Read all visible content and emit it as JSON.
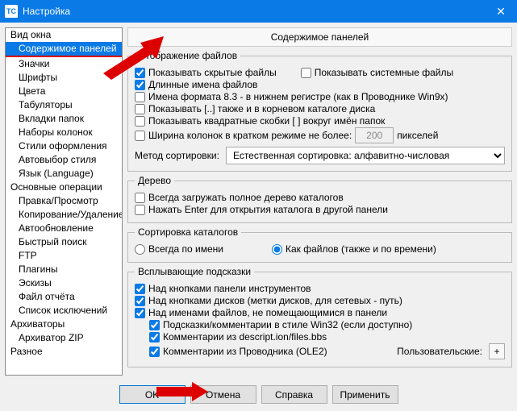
{
  "window": {
    "title": "Настройка"
  },
  "tree": {
    "items": [
      {
        "label": "Вид окна",
        "indent": 0
      },
      {
        "label": "Содержимое панелей",
        "indent": 1,
        "selected": true
      },
      {
        "label": "Значки",
        "indent": 1
      },
      {
        "label": "Шрифты",
        "indent": 1
      },
      {
        "label": "Цвета",
        "indent": 1
      },
      {
        "label": "Табуляторы",
        "indent": 1
      },
      {
        "label": "Вкладки папок",
        "indent": 1
      },
      {
        "label": "Наборы колонок",
        "indent": 1
      },
      {
        "label": "Стили оформления",
        "indent": 1
      },
      {
        "label": "Автовыбор стиля",
        "indent": 2
      },
      {
        "label": "Язык (Language)",
        "indent": 1
      },
      {
        "label": "Основные операции",
        "indent": 0
      },
      {
        "label": "Правка/Просмотр",
        "indent": 1
      },
      {
        "label": "Копирование/Удаление",
        "indent": 1
      },
      {
        "label": "Автообновление",
        "indent": 1
      },
      {
        "label": "Быстрый поиск",
        "indent": 1
      },
      {
        "label": "FTP",
        "indent": 1
      },
      {
        "label": "Плагины",
        "indent": 1
      },
      {
        "label": "Эскизы",
        "indent": 1
      },
      {
        "label": "Файл отчёта",
        "indent": 1
      },
      {
        "label": "Список исключений",
        "indent": 1
      },
      {
        "label": "Архиваторы",
        "indent": 0
      },
      {
        "label": "Архиватор ZIP",
        "indent": 1
      },
      {
        "label": "Разное",
        "indent": 0
      }
    ]
  },
  "header": "Содержимое панелей",
  "groups": {
    "display": {
      "legend": "Отображение файлов",
      "show_hidden": "Показывать скрытые файлы",
      "show_system": "Показывать системные файлы",
      "long_names": "Длинные имена файлов",
      "names_83": "Имена формата 8.3 - в нижнем регистре (как в Проводнике Win9x)",
      "show_dotdot": "Показывать [..] также и в корневом каталоге диска",
      "show_brackets": "Показывать квадратные скобки [ ] вокруг имён папок",
      "col_width_label": "Ширина колонок в кратком режиме не более:",
      "col_width_value": "200",
      "col_width_suffix": "пикселей",
      "sort_method_label": "Метод сортировки:",
      "sort_method_value": "Естественная сортировка: алфавитно-числовая"
    },
    "tree": {
      "legend": "Дерево",
      "always_load": "Всегда загружать полное дерево каталогов",
      "enter_open": "Нажать Enter для открытия каталога в другой панели"
    },
    "sort": {
      "legend": "Сортировка каталогов",
      "by_name": "Всегда по имени",
      "like_files": "Как файлов (также и по времени)"
    },
    "tooltips": {
      "legend": "Всплывающие подсказки",
      "over_toolbar": "Над кнопками панели инструментов",
      "over_drives": "Над кнопками дисков (метки дисков, для сетевых - путь)",
      "over_names": "Над именами файлов, не помещающимися в панели",
      "win32_hints": "Подсказки/комментарии в стиле Win32 (если доступно)",
      "descript_ion": "Комментарии из descript.ion/files.bbs",
      "ole2": "Комментарии из Проводника (OLE2)",
      "custom_label": "Пользовательские:",
      "plus": "+"
    }
  },
  "buttons": {
    "ok": "OK",
    "cancel": "Отмена",
    "help": "Справка",
    "apply": "Применить"
  }
}
